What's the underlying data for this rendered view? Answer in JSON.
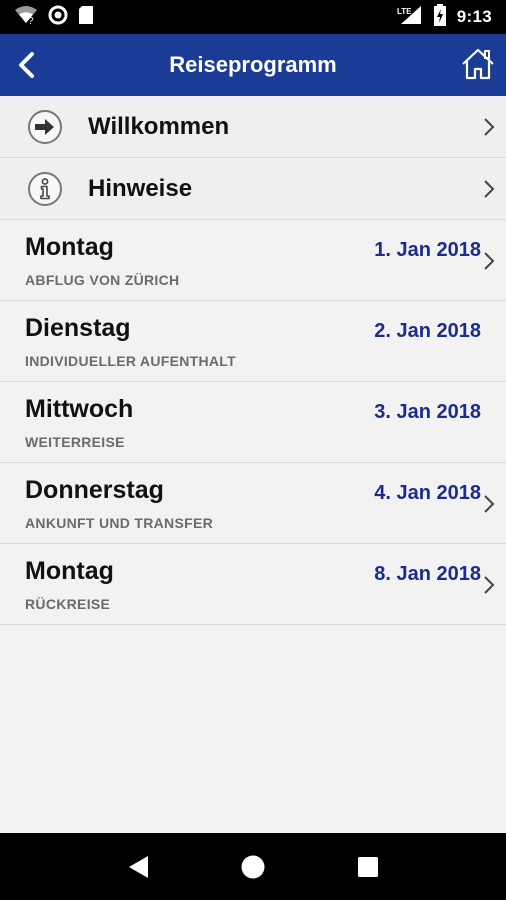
{
  "status_bar": {
    "time": "9:13",
    "network": "LTE",
    "icons": [
      "wifi-icon",
      "sync-icon",
      "sd-card-icon",
      "signal-icon",
      "battery-icon"
    ]
  },
  "app_bar": {
    "title": "Reiseprogramm",
    "back_icon": "back-chevron-icon",
    "home_icon": "home-icon",
    "background_color": "#1a3c96"
  },
  "menu_items": [
    {
      "label": "Willkommen",
      "icon": "arrow-right-circle-icon"
    },
    {
      "label": "Hinweise",
      "icon": "info-circle-icon"
    }
  ],
  "days": [
    {
      "name": "Montag",
      "subtitle": "ABFLUG VON ZÜRICH",
      "date": "1. Jan 2018",
      "has_chevron": true
    },
    {
      "name": "Dienstag",
      "subtitle": "INDIVIDUELLER AUFENTHALT",
      "date": "2. Jan 2018",
      "has_chevron": false
    },
    {
      "name": "Mittwoch",
      "subtitle": "WEITERREISE",
      "date": "3. Jan 2018",
      "has_chevron": false
    },
    {
      "name": "Donnerstag",
      "subtitle": "ANKUNFT UND TRANSFER",
      "date": "4. Jan 2018",
      "has_chevron": true
    },
    {
      "name": "Montag",
      "subtitle": "RÜCKREISE",
      "date": "8. Jan 2018",
      "has_chevron": true
    }
  ],
  "date_color": "#1a2d8a",
  "nav_bar": {
    "icons": [
      "nav-back-icon",
      "nav-home-icon",
      "nav-recents-icon"
    ]
  }
}
